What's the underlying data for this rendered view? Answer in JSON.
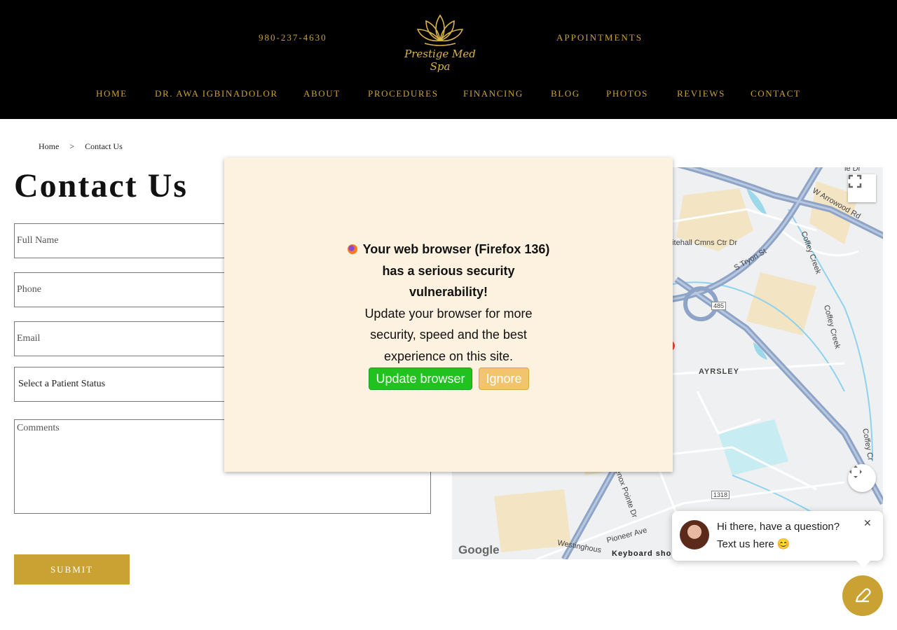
{
  "header": {
    "phone": "980-237-4630",
    "appointments": "APPOINTMENTS",
    "logo_text": "Prestige Med Spa",
    "nav": [
      {
        "label": "HOME"
      },
      {
        "label": "DR. AWA IGBINADOLOR"
      },
      {
        "label": "ABOUT"
      },
      {
        "label": "PROCEDURES"
      },
      {
        "label": "FINANCING"
      },
      {
        "label": "BLOG"
      },
      {
        "label": "PHOTOS"
      },
      {
        "label": "REVIEWS"
      },
      {
        "label": "CONTACT"
      }
    ]
  },
  "breadcrumb": {
    "home": "Home",
    "separator": ">",
    "current": "Contact Us"
  },
  "page": {
    "title": "Contact Us"
  },
  "form": {
    "full_name_placeholder": "Full Name",
    "phone_placeholder": "Phone",
    "email_placeholder": "Email",
    "patient_status": "Select a Patient Status",
    "comments_placeholder": "Comments",
    "submit_label": "SUBMIT"
  },
  "map": {
    "labels": {
      "arrowood": "W Arrowood Rd",
      "whitehall": "hitehall Cmns Ctr Dr",
      "tryon": "S Tryon St",
      "coffey1": "Coffey Creek",
      "coffey2": "Coffey Creek",
      "coffey3": "Coffey Cr",
      "ayrsley": "AYRSLEY",
      "route485": "485",
      "route1318": "1318",
      "lenox": "enox Pointe Dr",
      "pioneer": "Pioneer Ave",
      "westinghouse": "Westinghous",
      "top_right": "le Dr"
    },
    "google": "Google",
    "keyboard": "Keyboard sho"
  },
  "modal": {
    "line1": "Your web browser (Firefox 136)",
    "line2": "has a serious security",
    "line3": "vulnerability!",
    "line4": "Update your browser for more",
    "line5": "security, speed and the best",
    "line6": "experience on this site.",
    "update_label": "Update browser",
    "ignore_label": "Ignore"
  },
  "chat": {
    "line1": "Hi there, have a question?",
    "line2": "Text us here 😊",
    "close": "✕"
  },
  "colors": {
    "gold": "#c9a233",
    "header_bg": "#000000",
    "modal_bg": "#fdf2e0",
    "update_green": "#21c21f",
    "ignore_orange": "#f2c46b"
  }
}
